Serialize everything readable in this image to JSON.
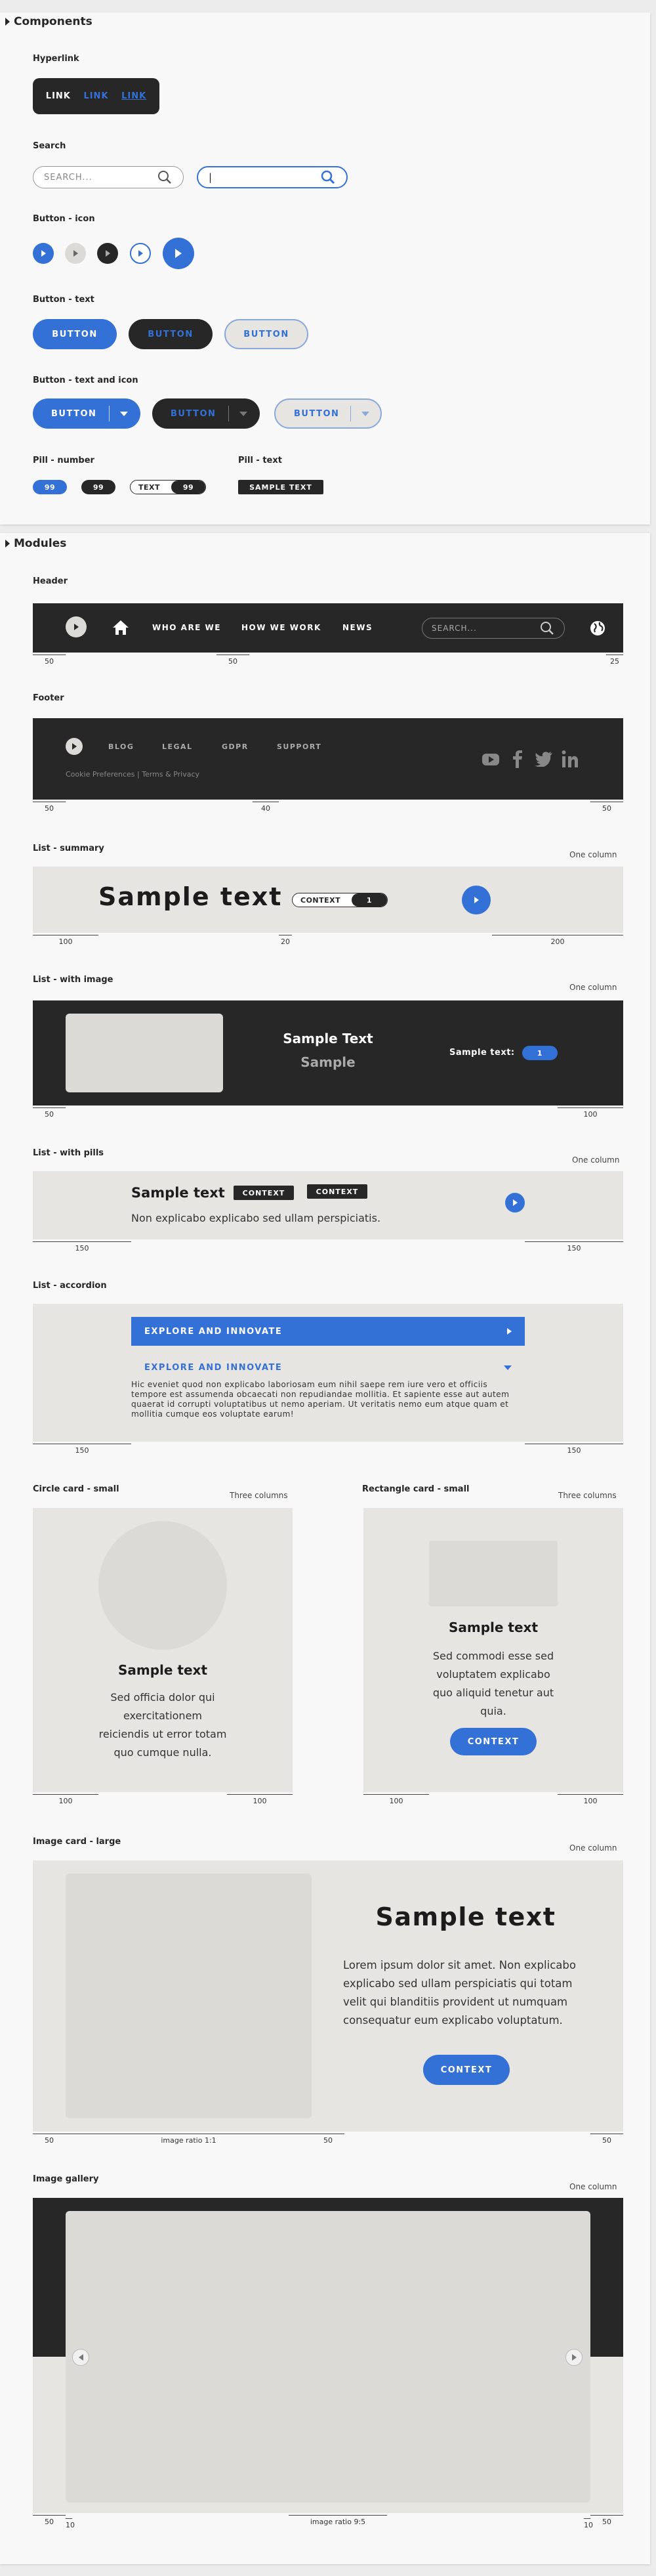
{
  "components": {
    "title": "Components",
    "hyperlink": {
      "label": "Hyperlink",
      "links": [
        "LINK",
        "LINK",
        "LINK"
      ]
    },
    "search": {
      "label": "Search",
      "placeholder": "SEARCH...",
      "active_value": "|"
    },
    "button_icon": {
      "label": "Button - icon"
    },
    "button_text": {
      "label": "Button - text",
      "buttons": [
        "BUTTON",
        "BUTTON",
        "BUTTON"
      ]
    },
    "button_text_icon": {
      "label": "Button - text and icon",
      "buttons": [
        "BUTTON",
        "BUTTON",
        "BUTTON"
      ]
    },
    "pill_number": {
      "label": "Pill - number",
      "pills": [
        "99",
        "99",
        "TEXT",
        "99"
      ]
    },
    "pill_text": {
      "label": "Pill - text",
      "pill": "SAMPLE TEXT"
    }
  },
  "modules": {
    "title": "Modules",
    "header": {
      "label": "Header",
      "nav": [
        "WHO ARE WE",
        "HOW WE WORK",
        "NEWS"
      ],
      "search_placeholder": "SEARCH...",
      "measures": [
        "50",
        "50",
        "25"
      ]
    },
    "footer": {
      "label": "Footer",
      "nav": [
        "BLOG",
        "LEGAL",
        "GDPR",
        "SUPPORT"
      ],
      "small": "Cookie Preferences | Terms & Privacy",
      "measures": [
        "50",
        "40",
        "50"
      ]
    },
    "list_summary": {
      "label": "List - summary",
      "note": "One column",
      "title": "Sample text",
      "pill_text": "CONTEXT",
      "pill_num": "1",
      "measures": [
        "100",
        "20",
        "200"
      ]
    },
    "list_image": {
      "label": "List - with image",
      "note": "One column",
      "title": "Sample Text",
      "subtitle": "Sample",
      "side_text": "Sample text:",
      "side_num": "1",
      "measures": [
        "50",
        "100"
      ]
    },
    "list_pills": {
      "label": "List - with pills",
      "note": "One column",
      "title": "Sample text",
      "pills": [
        "CONTEXT",
        "CONTEXT"
      ],
      "body": "Non explicabo explicabo sed ullam perspiciatis.",
      "measures": [
        "150",
        "150"
      ]
    },
    "list_accordion": {
      "label": "List - accordion",
      "closed_title": "EXPLORE AND INNOVATE",
      "open_title": "EXPLORE AND INNOVATE",
      "body": "Hic eveniet quod non explicabo laboriosam eum nihil saepe rem iure vero et officiis tempore est assumenda obcaecati non repudiandae mollitia. Et sapiente esse aut autem quaerat id corrupti voluptatibus ut nemo aperiam. Ut veritatis nemo eum atque quam et mollitia cumque eos voluptate earum!",
      "measures": [
        "150",
        "150"
      ]
    },
    "circle_card": {
      "label": "Circle card - small",
      "note": "Three columns",
      "title": "Sample text",
      "body": "Sed officia dolor qui exercitationem reiciendis ut error totam quo cumque nulla.",
      "measures": [
        "100",
        "100"
      ]
    },
    "rect_card": {
      "label": "Rectangle card - small",
      "note": "Three columns",
      "title": "Sample text",
      "body": "Sed commodi esse sed voluptatem explicabo quo aliquid tenetur aut quia.",
      "button": "CONTEXT",
      "measures": [
        "100",
        "100"
      ]
    },
    "image_card": {
      "label": "Image card - large",
      "note": "One column",
      "title": "Sample text",
      "body": "Lorem ipsum dolor sit amet. Non explicabo explicabo sed ullam perspiciatis qui totam velit qui blanditiis provident ut numquam consequatur eum explicabo voluptatum.",
      "button": "CONTEXT",
      "ratio": "image ratio 1:1",
      "measures": [
        "50",
        "50",
        "50"
      ]
    },
    "gallery": {
      "label": "Image gallery",
      "note": "One column",
      "ratio": "image ratio 9:5",
      "measures": [
        "50",
        "10",
        "10",
        "50"
      ]
    }
  },
  "colors": {
    "blue": "#3471d6",
    "dark": "#282727",
    "gray": "#dcdad6"
  }
}
